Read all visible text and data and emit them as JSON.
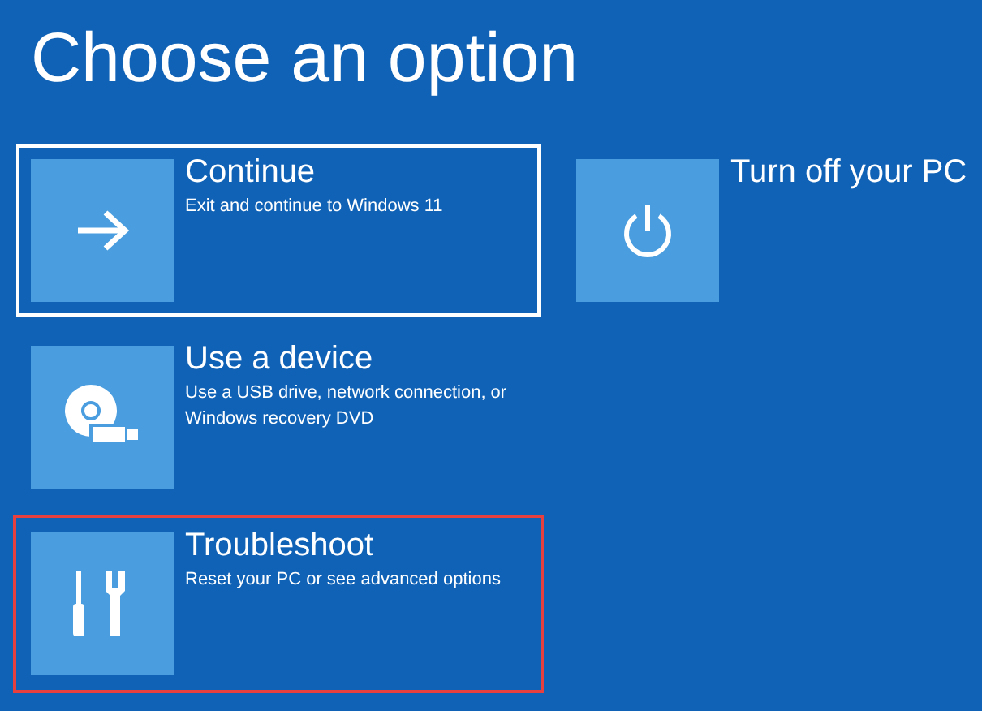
{
  "title": "Choose an option",
  "columns": [
    {
      "options": [
        {
          "kind": "arrow",
          "label": "Continue",
          "description": "Exit and continue to Windows 11",
          "selected": true,
          "highlighted": false
        },
        {
          "kind": "device",
          "label": "Use a device",
          "description": "Use a USB drive, network connection, or Windows recovery DVD",
          "selected": false,
          "highlighted": false
        },
        {
          "kind": "tools",
          "label": "Troubleshoot",
          "description": "Reset your PC or see advanced options",
          "selected": false,
          "highlighted": true
        }
      ]
    },
    {
      "options": [
        {
          "kind": "power",
          "label": "Turn off your PC",
          "selected": false,
          "highlighted": false
        }
      ]
    }
  ]
}
